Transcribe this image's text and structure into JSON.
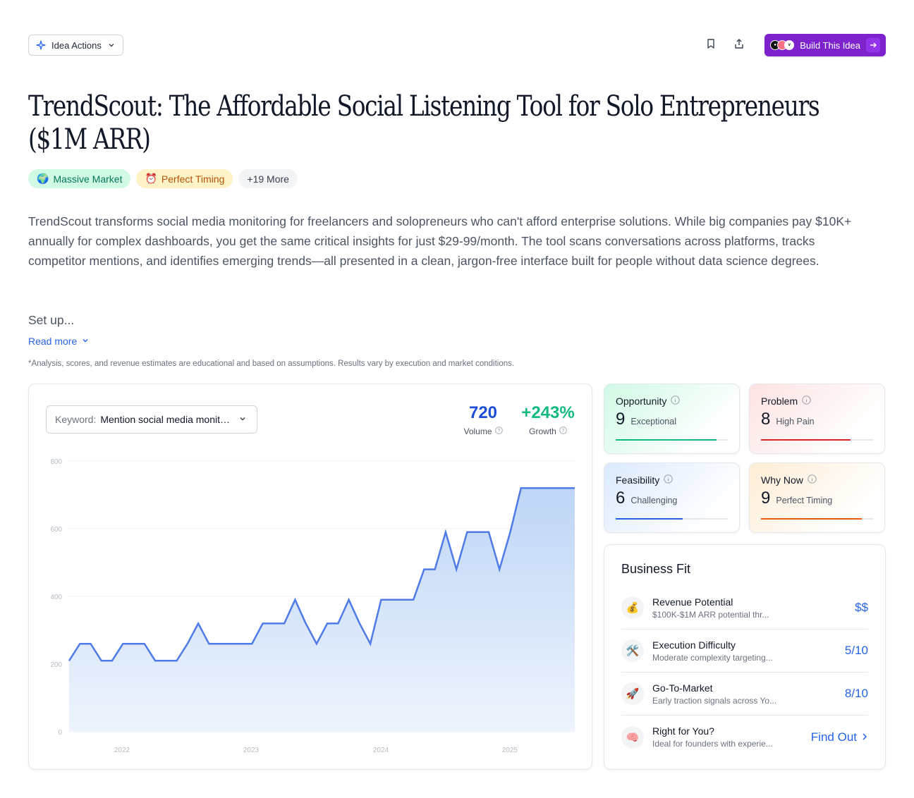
{
  "toolbar": {
    "idea_actions_label": "Idea Actions",
    "build_label": "Build This Idea",
    "brand_color": "#7e22ce"
  },
  "title": "TrendScout: The Affordable Social Listening Tool for Solo Entrepreneurs ($1M ARR)",
  "tags": [
    {
      "emoji": "🌍",
      "label": "Massive Market"
    },
    {
      "emoji": "⏰",
      "label": "Perfect Timing"
    },
    {
      "emoji": "",
      "label": "+19 More"
    }
  ],
  "description": "TrendScout transforms social media monitoring for freelancers and solopreneurs who can't afford enterprise solutions. While big companies pay $10K+ annually for complex dashboards, you get the same critical insights for just $29-99/month. The tool scans conversations across platforms, tracks competitor mentions, and identifies emerging trends—all presented in a clean, jargon-free interface built for people without data science degrees.",
  "setup_text": "Set up...",
  "read_more": "Read more",
  "disclaimer": "*Analysis, scores, and revenue estimates are educational and based on assumptions. Results vary by execution and market conditions.",
  "keyword": {
    "label": "Keyword:",
    "value": "Mention social media monitoring"
  },
  "stats": {
    "volume": {
      "value": "720",
      "label": "Volume",
      "color": "#1d4ed8"
    },
    "growth": {
      "value": "+243%",
      "label": "Growth",
      "color": "#10b981"
    }
  },
  "chart_data": {
    "type": "area",
    "y_ticks": [
      "800",
      "600",
      "400",
      "200",
      "0"
    ],
    "ylim": [
      0,
      800
    ],
    "x_ticks": [
      "2022",
      "2023",
      "2024",
      "2025"
    ],
    "line_color": "#4f7be8",
    "values": [
      210,
      260,
      260,
      210,
      210,
      260,
      260,
      260,
      210,
      210,
      210,
      260,
      320,
      260,
      260,
      260,
      260,
      260,
      320,
      320,
      320,
      390,
      320,
      260,
      320,
      320,
      390,
      320,
      260,
      390,
      390,
      390,
      390,
      480,
      480,
      590,
      480,
      590,
      590,
      590,
      480,
      590,
      720,
      720,
      720,
      720,
      720,
      720
    ]
  },
  "scores": [
    {
      "name": "Opportunity",
      "value": "9",
      "text": "Exceptional",
      "fill": 0.9,
      "color": "#10b981"
    },
    {
      "name": "Problem",
      "value": "8",
      "text": "High Pain",
      "fill": 0.8,
      "color": "#dc2626"
    },
    {
      "name": "Feasibility",
      "value": "6",
      "text": "Challenging",
      "fill": 0.6,
      "color": "#2563eb"
    },
    {
      "name": "Why Now",
      "value": "9",
      "text": "Perfect Timing",
      "fill": 0.9,
      "color": "#ea580c"
    }
  ],
  "business_fit": {
    "title": "Business Fit",
    "rows": [
      {
        "emoji": "💰",
        "title": "Revenue Potential",
        "sub": "$100K-$1M ARR potential thr...",
        "value": "$$"
      },
      {
        "emoji": "🛠️",
        "title": "Execution Difficulty",
        "sub": "Moderate complexity targeting...",
        "value": "5/10"
      },
      {
        "emoji": "🚀",
        "title": "Go-To-Market",
        "sub": "Early traction signals across Yo...",
        "value": "8/10"
      },
      {
        "emoji": "🧠",
        "title": "Right for You?",
        "sub": "Ideal for founders with experie...",
        "value": "Find Out"
      }
    ]
  }
}
